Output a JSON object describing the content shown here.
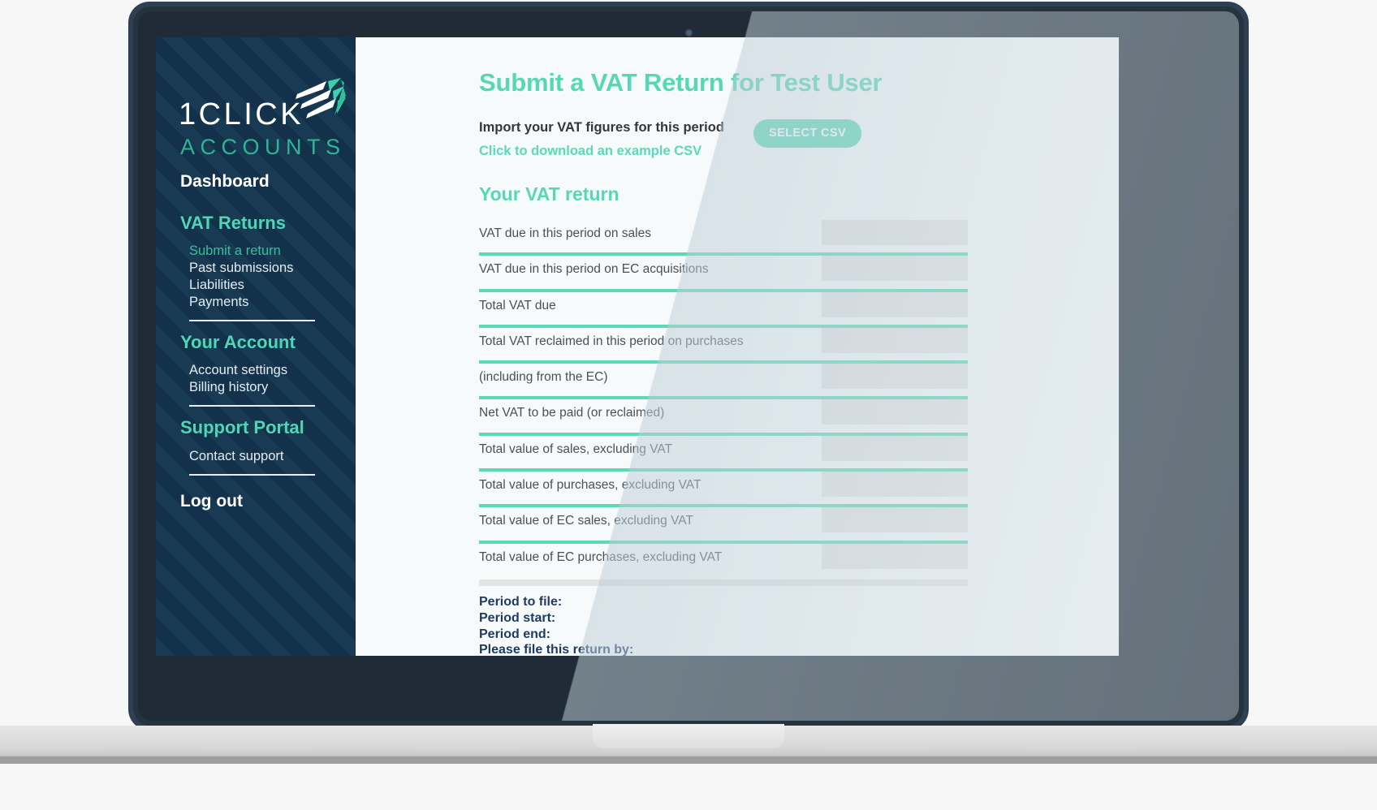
{
  "brand": {
    "logo_word_1": "1",
    "logo_word_2": "CLICK",
    "logo_subword": "ACCOUNTS",
    "flag_icon": "paper-plane-flag-icon",
    "accent_teal": "#5cd9b6",
    "brand_navy": "#143049"
  },
  "sidebar": {
    "dashboard_label": "Dashboard",
    "groups": [
      {
        "heading": "VAT Returns",
        "items": [
          {
            "label": "Submit a return",
            "active": true
          },
          {
            "label": "Past submissions",
            "active": false
          },
          {
            "label": "Liabilities",
            "active": false
          },
          {
            "label": "Payments",
            "active": false
          }
        ]
      },
      {
        "heading": "Your Account",
        "items": [
          {
            "label": "Account settings",
            "active": false
          },
          {
            "label": "Billing history",
            "active": false
          }
        ]
      },
      {
        "heading": "Support Portal",
        "items": [
          {
            "label": "Contact support",
            "active": false
          }
        ]
      }
    ],
    "logout_label": "Log out"
  },
  "main": {
    "page_title": "Submit a VAT Return for Test User",
    "import_label": "Import your VAT figures for this period",
    "example_csv_link": "Click to download an example CSV",
    "select_csv_button": "SELECT CSV",
    "section_title": "Your VAT return",
    "form_rows": [
      {
        "label": "VAT due in this period on sales",
        "value": ""
      },
      {
        "label": "VAT due in this period on EC acquisitions",
        "value": ""
      },
      {
        "label": "Total VAT due",
        "value": ""
      },
      {
        "label": "Total VAT reclaimed in this period on purchases",
        "value": ""
      },
      {
        "label": "(including from the EC)",
        "value": ""
      },
      {
        "label": "Net VAT to be paid (or reclaimed)",
        "value": ""
      },
      {
        "label": "Total value of sales, excluding VAT",
        "value": ""
      },
      {
        "label": "Total value of purchases, excluding VAT",
        "value": ""
      },
      {
        "label": "Total value of EC sales, excluding VAT",
        "value": ""
      },
      {
        "label": "Total value of EC purchases, excluding VAT",
        "value": ""
      }
    ],
    "period_lines": [
      "Period to file:",
      "Period start:",
      "Period end:",
      "Please file this return by:"
    ]
  },
  "device": {
    "webcam_icon": "webcam-dot-icon"
  }
}
